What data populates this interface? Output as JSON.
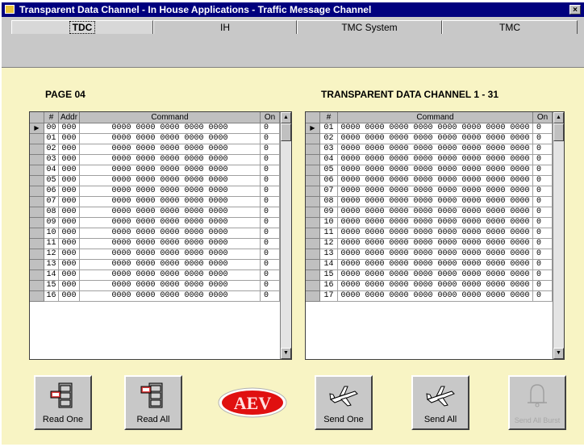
{
  "window": {
    "title": "Transparent Data Channel - In House Applications - Traffic Message Channel",
    "close_glyph": "×"
  },
  "tabs": [
    {
      "label": "TDC",
      "active": true
    },
    {
      "label": "IH",
      "active": false
    },
    {
      "label": "TMC System",
      "active": false
    },
    {
      "label": "TMC",
      "active": false
    }
  ],
  "left_panel": {
    "title": "PAGE 04",
    "columns": [
      "#",
      "Addr",
      "Command",
      "On"
    ],
    "rows": [
      {
        "num": "00",
        "addr": "000",
        "cmd": "0000 0000 0000 0000 0000",
        "on": "0",
        "current": true
      },
      {
        "num": "01",
        "addr": "000",
        "cmd": "0000 0000 0000 0000 0000",
        "on": "0"
      },
      {
        "num": "02",
        "addr": "000",
        "cmd": "0000 0000 0000 0000 0000",
        "on": "0"
      },
      {
        "num": "03",
        "addr": "000",
        "cmd": "0000 0000 0000 0000 0000",
        "on": "0"
      },
      {
        "num": "04",
        "addr": "000",
        "cmd": "0000 0000 0000 0000 0000",
        "on": "0"
      },
      {
        "num": "05",
        "addr": "000",
        "cmd": "0000 0000 0000 0000 0000",
        "on": "0"
      },
      {
        "num": "06",
        "addr": "000",
        "cmd": "0000 0000 0000 0000 0000",
        "on": "0"
      },
      {
        "num": "07",
        "addr": "000",
        "cmd": "0000 0000 0000 0000 0000",
        "on": "0"
      },
      {
        "num": "08",
        "addr": "000",
        "cmd": "0000 0000 0000 0000 0000",
        "on": "0"
      },
      {
        "num": "09",
        "addr": "000",
        "cmd": "0000 0000 0000 0000 0000",
        "on": "0"
      },
      {
        "num": "10",
        "addr": "000",
        "cmd": "0000 0000 0000 0000 0000",
        "on": "0"
      },
      {
        "num": "11",
        "addr": "000",
        "cmd": "0000 0000 0000 0000 0000",
        "on": "0"
      },
      {
        "num": "12",
        "addr": "000",
        "cmd": "0000 0000 0000 0000 0000",
        "on": "0"
      },
      {
        "num": "13",
        "addr": "000",
        "cmd": "0000 0000 0000 0000 0000",
        "on": "0"
      },
      {
        "num": "14",
        "addr": "000",
        "cmd": "0000 0000 0000 0000 0000",
        "on": "0"
      },
      {
        "num": "15",
        "addr": "000",
        "cmd": "0000 0000 0000 0000 0000",
        "on": "0"
      },
      {
        "num": "16",
        "addr": "000",
        "cmd": "0000 0000 0000 0000 0000",
        "on": "0"
      }
    ]
  },
  "right_panel": {
    "title": "TRANSPARENT DATA CHANNEL 1 - 31",
    "columns": [
      "#",
      "Command",
      "On"
    ],
    "rows": [
      {
        "num": "01",
        "cmd": "0000 0000 0000 0000 0000 0000 0000 0000",
        "on": "0",
        "current": true
      },
      {
        "num": "02",
        "cmd": "0000 0000 0000 0000 0000 0000 0000 0000",
        "on": "0"
      },
      {
        "num": "03",
        "cmd": "0000 0000 0000 0000 0000 0000 0000 0000",
        "on": "0"
      },
      {
        "num": "04",
        "cmd": "0000 0000 0000 0000 0000 0000 0000 0000",
        "on": "0"
      },
      {
        "num": "05",
        "cmd": "0000 0000 0000 0000 0000 0000 0000 0000",
        "on": "0"
      },
      {
        "num": "06",
        "cmd": "0000 0000 0000 0000 0000 0000 0000 0000",
        "on": "0"
      },
      {
        "num": "07",
        "cmd": "0000 0000 0000 0000 0000 0000 0000 0000",
        "on": "0"
      },
      {
        "num": "08",
        "cmd": "0000 0000 0000 0000 0000 0000 0000 0000",
        "on": "0"
      },
      {
        "num": "09",
        "cmd": "0000 0000 0000 0000 0000 0000 0000 0000",
        "on": "0"
      },
      {
        "num": "10",
        "cmd": "0000 0000 0000 0000 0000 0000 0000 0000",
        "on": "0"
      },
      {
        "num": "11",
        "cmd": "0000 0000 0000 0000 0000 0000 0000 0000",
        "on": "0"
      },
      {
        "num": "12",
        "cmd": "0000 0000 0000 0000 0000 0000 0000 0000",
        "on": "0"
      },
      {
        "num": "13",
        "cmd": "0000 0000 0000 0000 0000 0000 0000 0000",
        "on": "0"
      },
      {
        "num": "14",
        "cmd": "0000 0000 0000 0000 0000 0000 0000 0000",
        "on": "0"
      },
      {
        "num": "15",
        "cmd": "0000 0000 0000 0000 0000 0000 0000 0000",
        "on": "0"
      },
      {
        "num": "16",
        "cmd": "0000 0000 0000 0000 0000 0000 0000 0000",
        "on": "0"
      },
      {
        "num": "17",
        "cmd": "0000 0000 0000 0000 0000 0000 0000 0000",
        "on": "0"
      }
    ]
  },
  "buttons": {
    "read_one": {
      "label": "Read One",
      "icon": "cabinet-icon"
    },
    "read_all": {
      "label": "Read All",
      "icon": "cabinet-icon"
    },
    "send_one": {
      "label": "Send One",
      "icon": "airplane-icon"
    },
    "send_all": {
      "label": "Send All",
      "icon": "airplane-icon"
    },
    "send_all_burst": {
      "label": "Send All Burst",
      "icon": "bell-icon",
      "disabled": true
    }
  },
  "logo": {
    "text": "AEV",
    "color": "#e01010"
  },
  "colors": {
    "title_bar": "#00007e",
    "panel_background": "#f8f4c4",
    "tab_strip": "#c8c8c8"
  }
}
